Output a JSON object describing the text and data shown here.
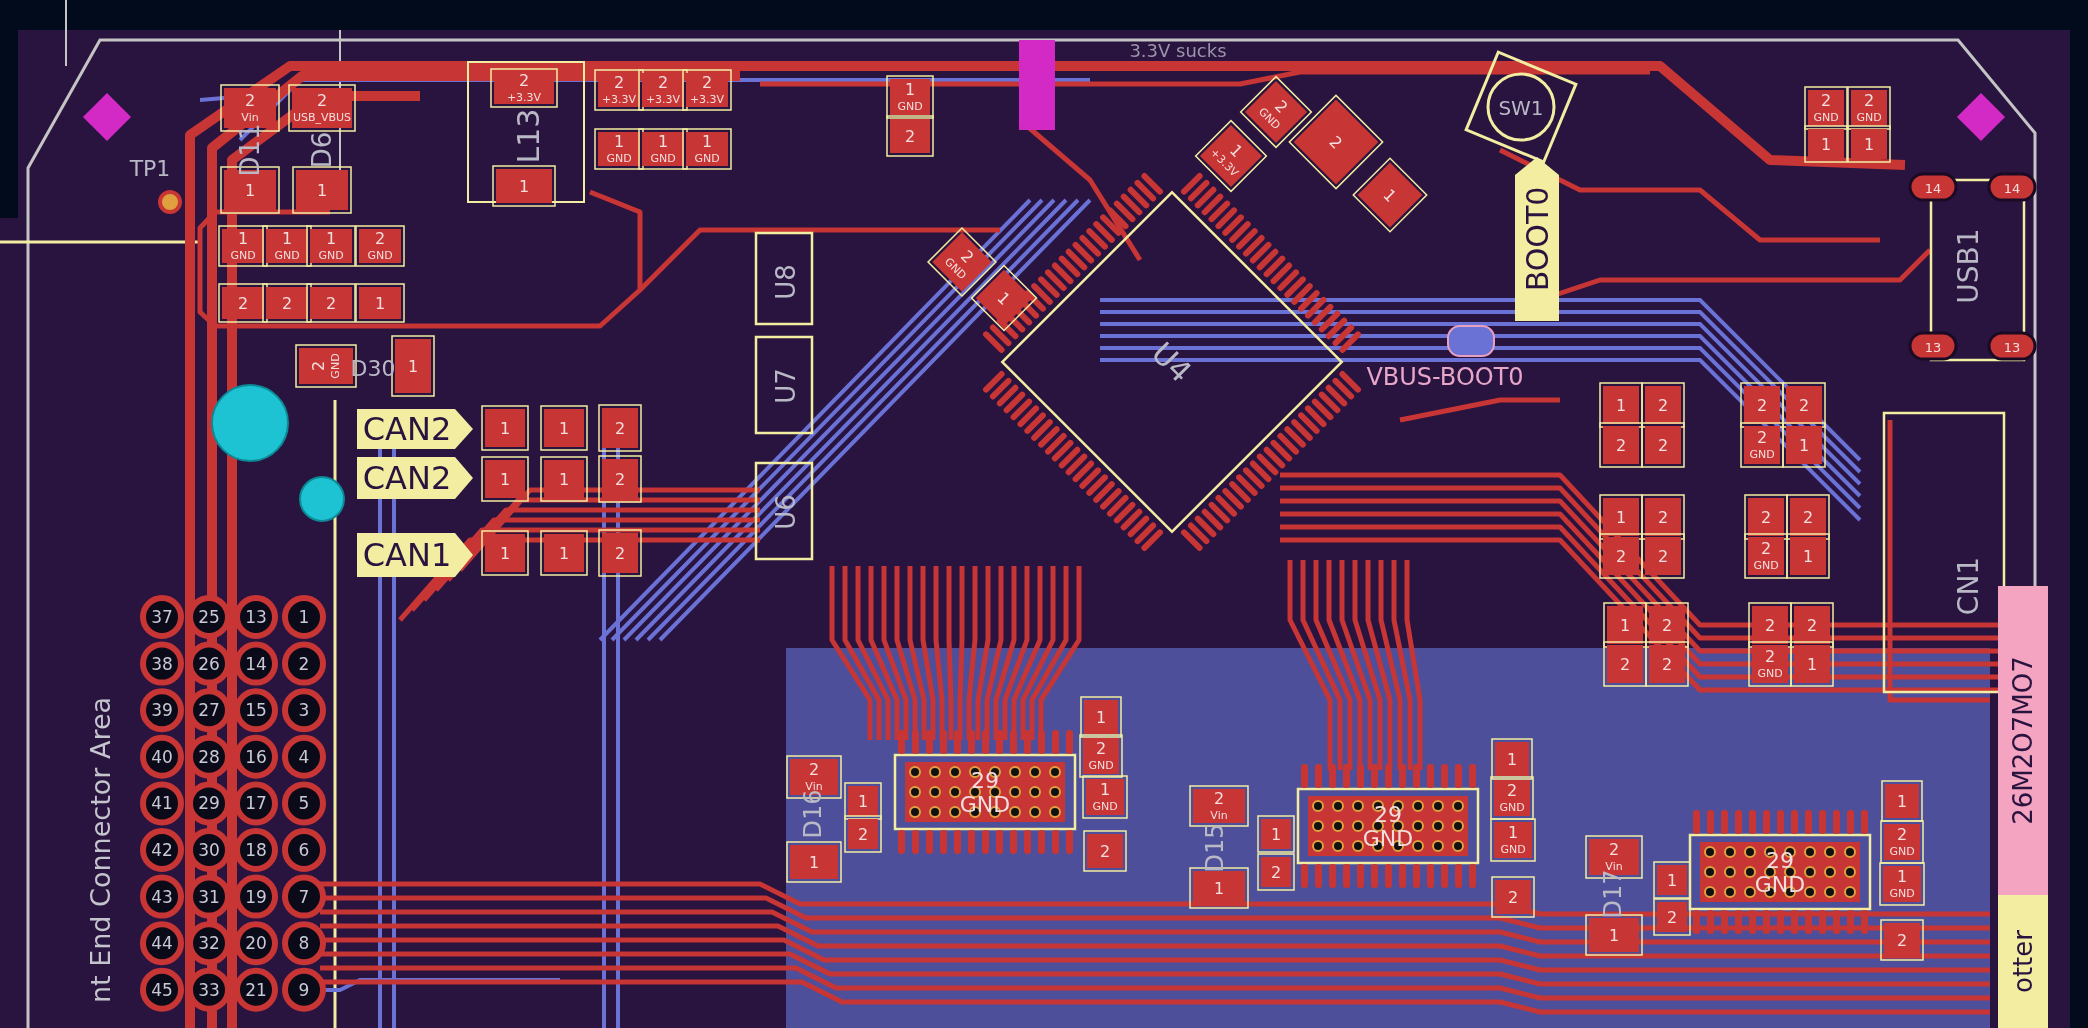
{
  "board": {
    "comment_text": "3.3V sucks",
    "silkscreen_labels": [
      {
        "text": "D11"
      },
      {
        "text": "D6"
      },
      {
        "text": "TP1"
      },
      {
        "text": "L13"
      },
      {
        "text": "D30"
      },
      {
        "text": "U8"
      },
      {
        "text": "U7"
      },
      {
        "text": "U6"
      },
      {
        "text": "U4"
      },
      {
        "text": "SW1"
      },
      {
        "text": "USB1"
      },
      {
        "text": "CN1"
      },
      {
        "text": "D16"
      },
      {
        "text": "D15"
      },
      {
        "text": "D17"
      }
    ],
    "back_side_labels": [
      {
        "text": "VBUS-BOOT0"
      }
    ],
    "net_flags": [
      {
        "text": "CAN2"
      },
      {
        "text": "CAN2"
      },
      {
        "text": "CAN1"
      },
      {
        "text": "BOOT0"
      }
    ],
    "pads": [
      {
        "kind": "smd",
        "number": "2",
        "net": "Vin"
      },
      {
        "kind": "smd",
        "number": "2",
        "net": "USB_VBUS"
      },
      {
        "kind": "smd",
        "number": "1"
      },
      {
        "kind": "smd",
        "number": "1"
      },
      {
        "kind": "smd",
        "number": "2",
        "net": "+3.3V"
      },
      {
        "kind": "smd",
        "number": "1"
      },
      {
        "kind": "smd",
        "number": "1",
        "net": "GND"
      },
      {
        "kind": "smd",
        "number": "1",
        "net": "GND"
      },
      {
        "kind": "smd",
        "number": "1",
        "net": "GND"
      },
      {
        "kind": "smd",
        "number": "2",
        "net": "GND"
      },
      {
        "kind": "smd",
        "number": "2"
      },
      {
        "kind": "smd",
        "number": "2"
      },
      {
        "kind": "smd",
        "number": "2"
      },
      {
        "kind": "smd",
        "number": "1"
      },
      {
        "kind": "smd",
        "number": "2",
        "net": "+3.3V"
      },
      {
        "kind": "smd",
        "number": "2",
        "net": "+3.3V"
      },
      {
        "kind": "smd",
        "number": "2",
        "net": "+3.3V"
      },
      {
        "kind": "smd",
        "number": "1",
        "net": "GND"
      },
      {
        "kind": "smd",
        "number": "1",
        "net": "GND"
      },
      {
        "kind": "smd",
        "number": "1",
        "net": "GND"
      },
      {
        "kind": "smd",
        "number": "2",
        "net": "GND"
      },
      {
        "kind": "smd",
        "number": "1"
      },
      {
        "kind": "smd",
        "number": "1"
      },
      {
        "kind": "smd",
        "number": "1"
      },
      {
        "kind": "smd",
        "number": "2"
      },
      {
        "kind": "smd",
        "number": "1"
      },
      {
        "kind": "smd",
        "number": "1"
      },
      {
        "kind": "smd",
        "number": "2"
      },
      {
        "kind": "smd",
        "number": "1"
      },
      {
        "kind": "smd",
        "number": "1"
      },
      {
        "kind": "smd",
        "number": "2"
      },
      {
        "kind": "smd",
        "number": "1",
        "net": "GND"
      },
      {
        "kind": "smd",
        "number": "2"
      },
      {
        "kind": "smd",
        "number": "2",
        "net": "GND"
      },
      {
        "kind": "smd",
        "number": "1",
        "net": "+3.3V"
      },
      {
        "kind": "smd",
        "number": "2"
      },
      {
        "kind": "smd",
        "number": "1"
      },
      {
        "kind": "smd",
        "number": "2",
        "net": "GND"
      },
      {
        "kind": "smd",
        "number": "1"
      },
      {
        "kind": "smd",
        "number": "2",
        "net": "Vin"
      },
      {
        "kind": "smd",
        "number": "1"
      },
      {
        "kind": "smd",
        "number": "2",
        "net": "Vin"
      },
      {
        "kind": "smd",
        "number": "1"
      },
      {
        "kind": "smd",
        "number": "2",
        "net": "Vin"
      },
      {
        "kind": "smd",
        "number": "1"
      },
      {
        "kind": "smd",
        "number": "1"
      },
      {
        "kind": "smd",
        "number": "2",
        "net": "GND"
      },
      {
        "kind": "smd",
        "number": "1",
        "net": "GND"
      },
      {
        "kind": "smd",
        "number": "2"
      },
      {
        "kind": "smd",
        "number": "1"
      },
      {
        "kind": "smd",
        "number": "2",
        "net": "GND"
      },
      {
        "kind": "smd",
        "number": "1",
        "net": "GND"
      },
      {
        "kind": "smd",
        "number": "2"
      },
      {
        "kind": "smd",
        "number": "1"
      },
      {
        "kind": "smd",
        "number": "2",
        "net": "GND"
      },
      {
        "kind": "smd",
        "number": "1",
        "net": "GND"
      },
      {
        "kind": "smd",
        "number": "2"
      },
      {
        "kind": "smd",
        "number": "1"
      },
      {
        "kind": "smd",
        "number": "2"
      },
      {
        "kind": "smd",
        "number": "1"
      },
      {
        "kind": "smd",
        "number": "2"
      },
      {
        "kind": "smd",
        "number": "1"
      },
      {
        "kind": "smd",
        "number": "2"
      },
      {
        "kind": "smd",
        "number": "1"
      },
      {
        "kind": "smd",
        "number": "2"
      },
      {
        "kind": "smd",
        "number": "2"
      },
      {
        "kind": "smd",
        "number": "2"
      },
      {
        "kind": "smd",
        "number": "2"
      },
      {
        "kind": "smd",
        "number": "2",
        "net": "GND"
      },
      {
        "kind": "smd",
        "number": "2"
      },
      {
        "kind": "smd",
        "number": "1"
      },
      {
        "kind": "smd",
        "number": "1"
      },
      {
        "kind": "smd",
        "number": "2"
      },
      {
        "kind": "smd",
        "number": "2"
      },
      {
        "kind": "smd",
        "number": "2"
      },
      {
        "kind": "smd",
        "number": "2"
      },
      {
        "kind": "smd",
        "number": "2",
        "net": "GND"
      },
      {
        "kind": "smd",
        "number": "2"
      },
      {
        "kind": "smd",
        "number": "1"
      },
      {
        "kind": "smd",
        "number": "1"
      },
      {
        "kind": "smd",
        "number": "2"
      },
      {
        "kind": "smd",
        "number": "2"
      },
      {
        "kind": "smd",
        "number": "2"
      },
      {
        "kind": "smd",
        "number": "2"
      },
      {
        "kind": "smd",
        "number": "2",
        "net": "GND"
      },
      {
        "kind": "smd",
        "number": "2"
      },
      {
        "kind": "smd",
        "number": "1"
      },
      {
        "kind": "smd",
        "number": "2",
        "net": "GND"
      },
      {
        "kind": "smd",
        "number": "2",
        "net": "GND"
      },
      {
        "kind": "smd",
        "number": "1"
      },
      {
        "kind": "smd",
        "number": "1"
      },
      {
        "kind": "oval",
        "number": "14"
      },
      {
        "kind": "oval",
        "number": "14"
      },
      {
        "kind": "oval",
        "number": "13"
      },
      {
        "kind": "oval",
        "number": "13"
      }
    ],
    "front_end_connector": {
      "label": "nt End Connector Area",
      "pins": [
        [
          "37",
          "25",
          "13",
          "1"
        ],
        [
          "38",
          "26",
          "14",
          "2"
        ],
        [
          "39",
          "27",
          "15",
          "3"
        ],
        [
          "40",
          "28",
          "16",
          "4"
        ],
        [
          "41",
          "29",
          "17",
          "5"
        ],
        [
          "42",
          "30",
          "18",
          "6"
        ],
        [
          "43",
          "31",
          "19",
          "7"
        ],
        [
          "44",
          "32",
          "20",
          "8"
        ],
        [
          "45",
          "33",
          "21",
          "9"
        ]
      ]
    },
    "board_connectors": [
      {
        "pin_label": "29",
        "net": "GND"
      },
      {
        "pin_label": "29",
        "net": "GND"
      },
      {
        "pin_label": "29",
        "net": "GND"
      }
    ],
    "edge_text": [
      {
        "text": "26M2O7MO7",
        "color": "#f4a3c0"
      },
      {
        "text": "otter",
        "color": "#f2eda1"
      }
    ]
  }
}
